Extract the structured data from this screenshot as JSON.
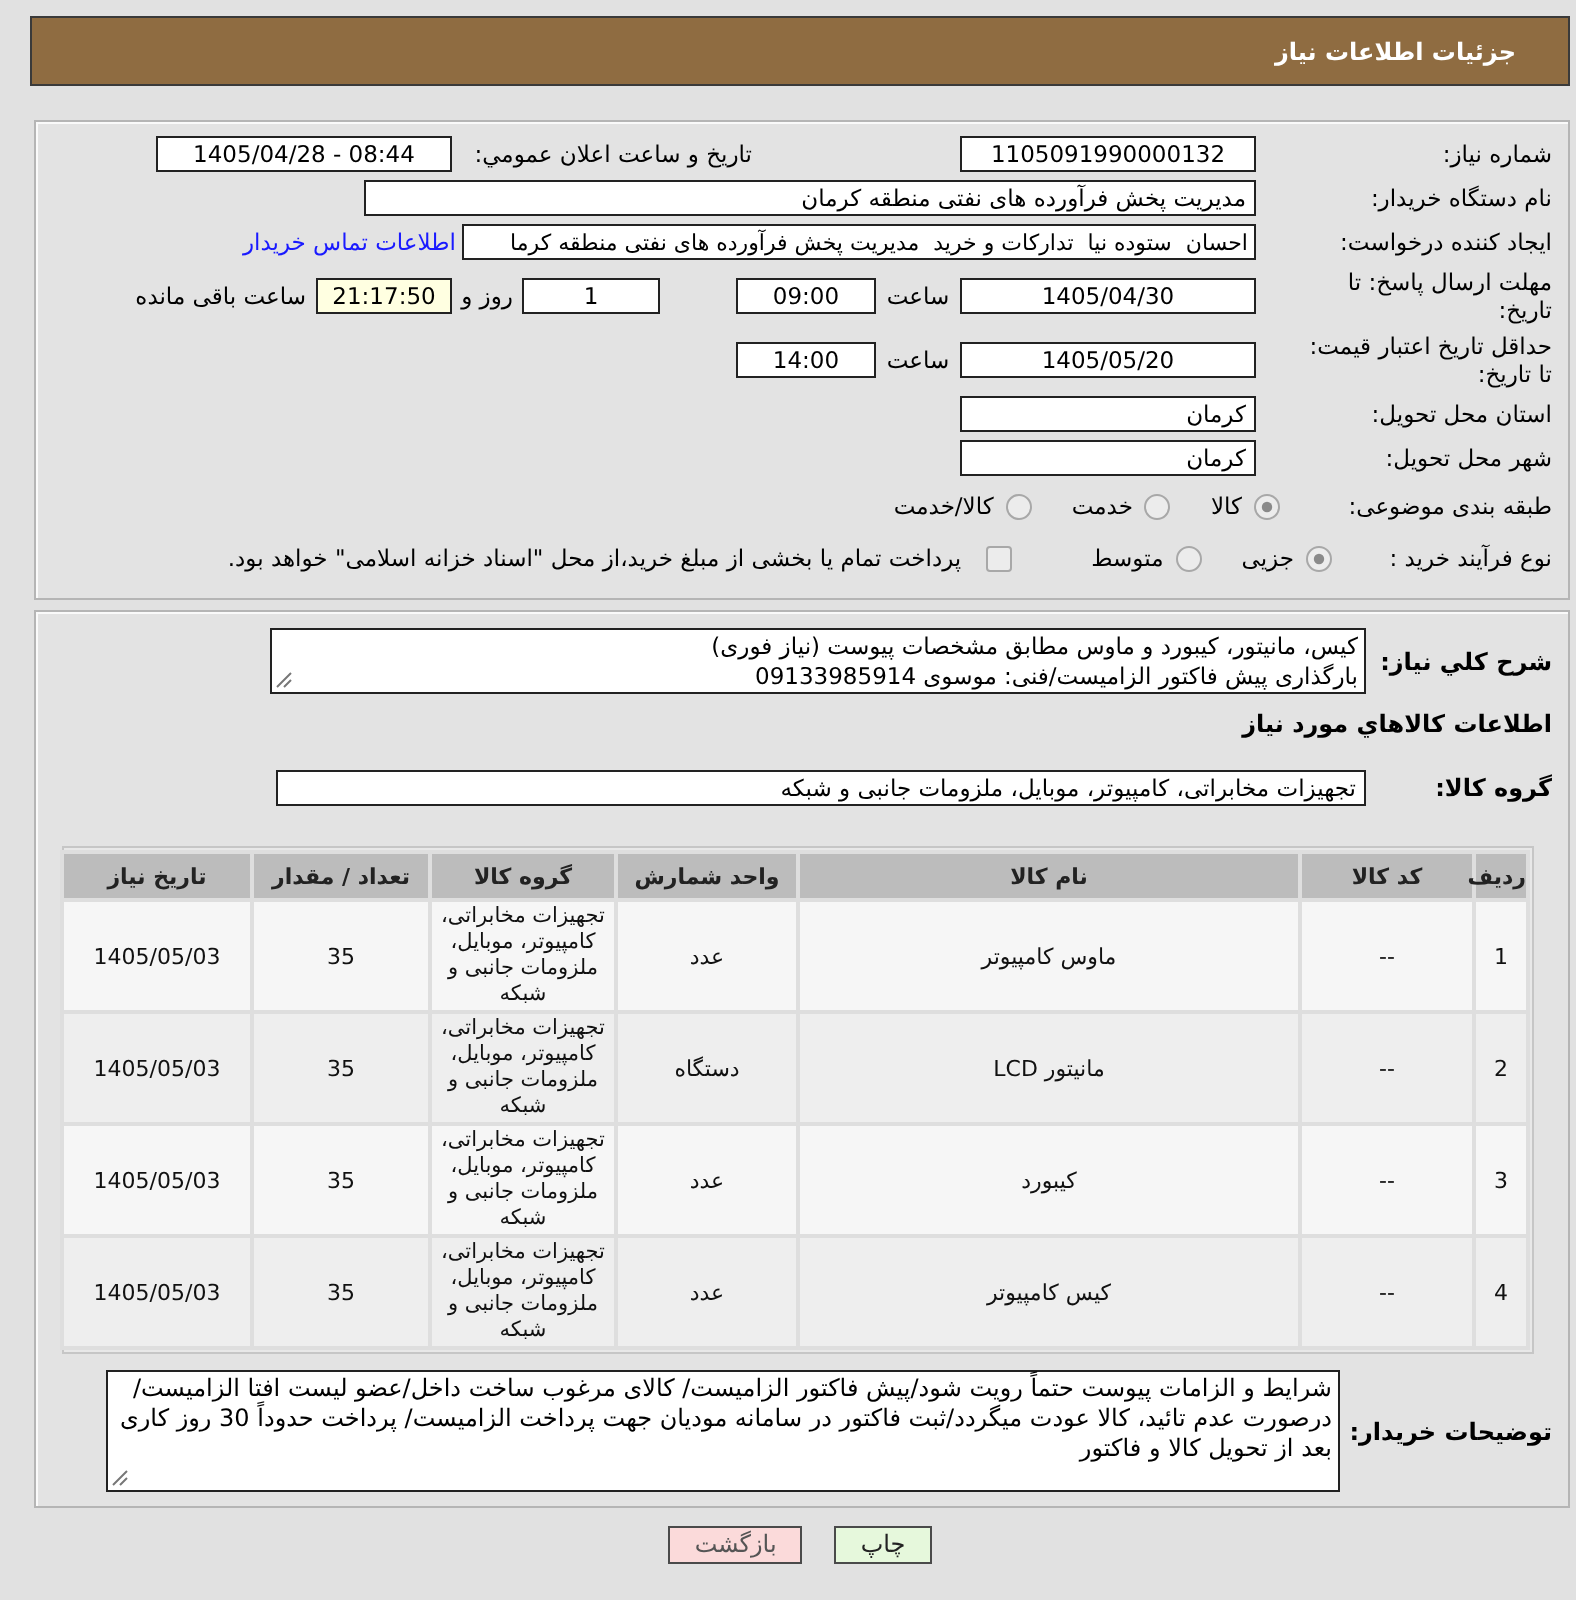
{
  "header": {
    "title": "جزئیات اطلاعات نیاز"
  },
  "details": {
    "need_number": {
      "label": "شماره نیاز:",
      "value": "1105091990000132"
    },
    "announcement": {
      "label": "تاریخ و ساعت اعلان عمومي:",
      "value": "1405/04/28 - 08:44"
    },
    "buyer_org": {
      "label": "نام دستگاه خریدار:",
      "value": "مدیریت پخش فرآورده های نفتی منطقه کرمان"
    },
    "requester": {
      "label": "ایجاد کننده درخواست:",
      "value": "احسان  ستوده نیا  تدارکات و خرید  مدیریت پخش فرآورده های نفتی منطقه کرما",
      "link": "اطلاعات تماس خریدار"
    },
    "response_deadline": {
      "label": "مهلت ارسال پاسخ: تا تاریخ:",
      "date": "1405/04/30",
      "time_label": "ساعت",
      "time": "09:00",
      "days": "1",
      "days_label": "روز و",
      "remaining": "21:17:50",
      "remaining_label": "ساعت باقی مانده"
    },
    "price_validity": {
      "label": "حداقل تاریخ اعتبار قیمت: تا تاریخ:",
      "date": "1405/05/20",
      "time_label": "ساعت",
      "time": "14:00"
    },
    "delivery_province": {
      "label": "استان محل تحویل:",
      "value": "کرمان"
    },
    "delivery_city": {
      "label": "شهر محل تحویل:",
      "value": "کرمان"
    },
    "category": {
      "label": "طبقه بندی موضوعی:",
      "options": [
        {
          "label": "کالا",
          "selected": true
        },
        {
          "label": "خدمت",
          "selected": false
        },
        {
          "label": "کالا/خدمت",
          "selected": false
        }
      ]
    },
    "purchase_process": {
      "label": "نوع فرآیند خرید :",
      "options": [
        {
          "label": "جزیی",
          "selected": true
        },
        {
          "label": "متوسط",
          "selected": false
        }
      ],
      "treasury_payment": {
        "label": "پرداخت تمام یا بخشی از مبلغ خرید،از محل \"اسناد خزانه اسلامی\" خواهد بود.",
        "checked": false
      }
    }
  },
  "summary": {
    "label": "شرح کلي نیاز:",
    "value": "کیس، مانیتور، کیبورد و ماوس مطابق مشخصات پیوست (نیاز فوری)\nبارگذاری پیش فاکتور الزامیست/فنی: موسوی 09133985914"
  },
  "goods": {
    "title": "اطلاعات کالاهاي مورد نیاز",
    "group": {
      "label": "گروه کالا:",
      "value": "تجهیزات مخابراتی، کامپیوتر، موبایل، ملزومات جانبی و شبکه"
    },
    "table": {
      "columns": [
        "ردیف",
        "کد کالا",
        "نام کالا",
        "واحد شمارش",
        "گروه کالا",
        "تعداد / مقدار",
        "تاریخ نیاز"
      ],
      "rows": [
        {
          "cells": [
            "1",
            "--",
            "ماوس کامپیوتر",
            "عدد",
            "تجهیزات مخابراتی، کامپیوتر، موبایل، ملزومات جانبی و شبکه",
            "35",
            "1405/05/03"
          ]
        },
        {
          "cells": [
            "2",
            "--",
            "مانیتور LCD",
            "دستگاه",
            "تجهیزات مخابراتی، کامپیوتر، موبایل، ملزومات جانبی و شبکه",
            "35",
            "1405/05/03"
          ]
        },
        {
          "cells": [
            "3",
            "--",
            "کیبورد",
            "عدد",
            "تجهیزات مخابراتی، کامپیوتر، موبایل، ملزومات جانبی و شبکه",
            "35",
            "1405/05/03"
          ]
        },
        {
          "cells": [
            "4",
            "--",
            "کیس کامپیوتر",
            "عدد",
            "تجهیزات مخابراتی، کامپیوتر، موبایل، ملزومات جانبی و شبکه",
            "35",
            "1405/05/03"
          ]
        }
      ]
    }
  },
  "buyer_notes": {
    "label": "توضیحات خریدار:",
    "value": "شرایط و الزامات پیوست حتماً رویت شود/پیش فاکتور الزامیست/ کالای مرغوب ساخت داخل/عضو لیست افتا الزامیست/ درصورت عدم تائید، کالا عودت میگردد/ثبت فاکتور در سامانه مودیان جهت پرداخت الزامیست/ پرداخت حدوداً 30 روز کاری بعد از تحویل کالا و فاکتور"
  },
  "buttons": [
    {
      "label": "چاپ",
      "kind": "print"
    },
    {
      "label": "بازگشت",
      "kind": "back"
    }
  ]
}
